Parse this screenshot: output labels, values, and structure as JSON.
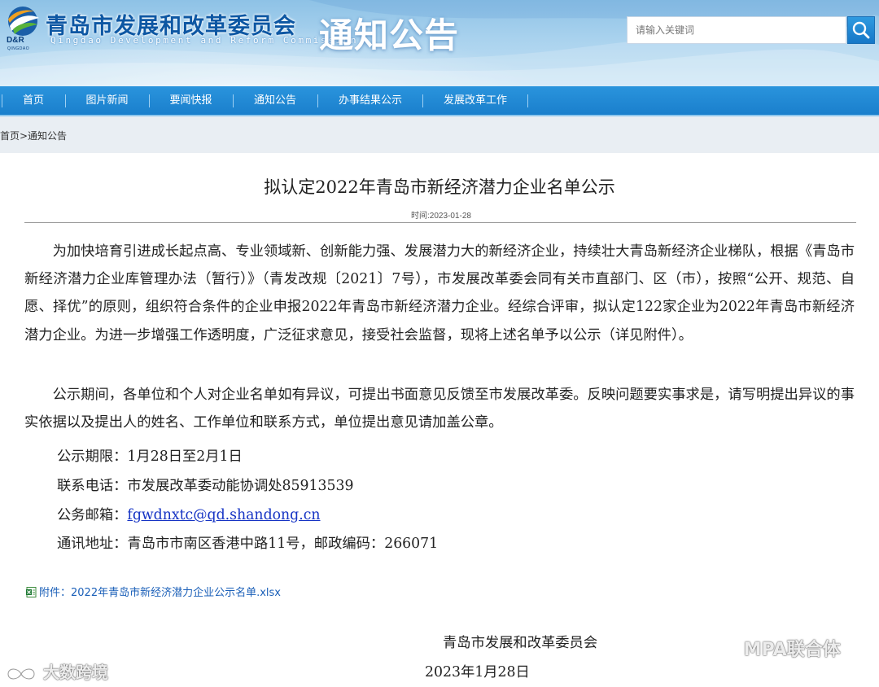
{
  "header": {
    "logo_text": "D&R",
    "logo_sub": "QINGDAO",
    "site_title_cn": "青岛市发展和改革委员会",
    "site_title_en": "Qingdao Development and Reform Commission",
    "section_title": "通知公告",
    "search_placeholder": "请输入关键词"
  },
  "nav": {
    "items": [
      "首页",
      "图片新闻",
      "要闻快报",
      "通知公告",
      "办事结果公示",
      "发展改革工作"
    ]
  },
  "breadcrumb": "首页>通知公告",
  "article": {
    "title": "拟认定2022年青岛市新经济潜力企业名单公示",
    "time": "时间:2023-01-28",
    "paragraph1": "为加快培育引进成长起点高、专业领域新、创新能力强、发展潜力大的新经济企业，持续壮大青岛新经济企业梯队，根据《青岛市新经济潜力企业库管理办法（暂行）》（青发改规〔2021〕7号），市发展改革委会同有关市直部门、区（市），按照“公开、规范、自愿、择优”的原则，组织符合条件的企业申报2022年青岛市新经济潜力企业。经综合评审，拟认定122家企业为2022年青岛市新经济潜力企业。为进一步增强工作透明度，广泛征求意见，接受社会监督，现将上述名单予以公示（详见附件）。",
    "paragraph2": "公示期间，各单位和个人对企业名单如有异议，可提出书面意见反馈至市发展改革委。反映问题要实事求是，请写明提出异议的事实依据以及提出人的姓名、工作单位和联系方式，单位提出意见请加盖公章。",
    "period_label": "公示期限：",
    "period_value": "1月28日至2月1日",
    "phone_label": "联系电话：",
    "phone_value": "市发展改革委动能协调处85913539",
    "email_label": "公务邮箱：",
    "email_value": "fgwdnxtc@qd.shandong.cn",
    "address_label": "通讯地址：",
    "address_value": "青岛市市南区香港中路11号，邮政编码：266071",
    "attachment": "附件：2022年青岛市新经济潜力企业公示名单.xlsx",
    "sign_org": "青岛市发展和改革委员会",
    "sign_date": "2023年1月28日"
  },
  "watermarks": {
    "left": "大数跨境",
    "right": "MPA联合体"
  }
}
